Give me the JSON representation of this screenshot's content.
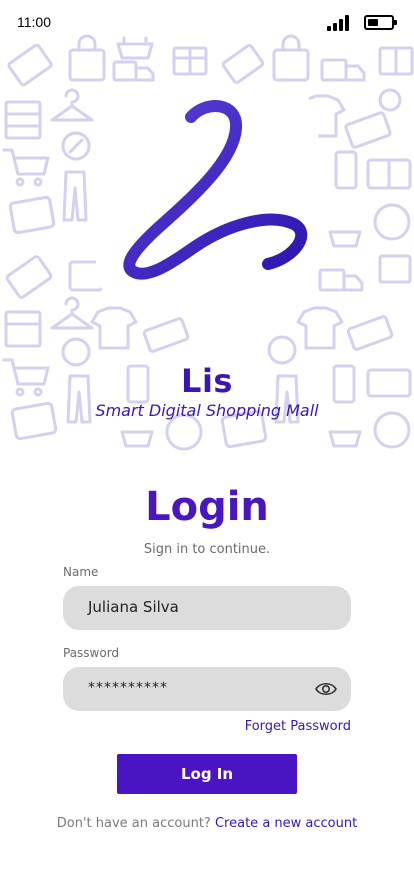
{
  "status_bar": {
    "time": "11:00",
    "signal_icon": "cellular-signal-icon",
    "battery_icon": "battery-icon",
    "battery_level": 0.45
  },
  "hero": {
    "logo_icon": "lis-script-logo",
    "brand_name": "Lis",
    "tagline": "Smart Digital Shopping Mall",
    "pattern_icons": [
      "new-tag-icon",
      "shopping-bag-icon",
      "basket-icon",
      "gift-icon",
      "truck-icon",
      "shirt-icon",
      "percent-icon",
      "cart-icon",
      "wallet-icon",
      "sale-tag-icon",
      "hanger-icon",
      "store-icon",
      "pants-icon",
      "card-icon"
    ],
    "colors": {
      "brand": "#3a16b5",
      "pattern": "#d4d0ef"
    }
  },
  "login": {
    "title": "Login",
    "subtitle": "Sign in to continue.",
    "name_label": "Name",
    "name_value": "Juliana Silva",
    "password_label": "Password",
    "password_value": "**********",
    "show_password_icon": "eye-icon",
    "forgot_label": "Forget Password",
    "login_button": "Log In",
    "no_account_text": "Don't have an account?",
    "create_account_link": "Create a new account",
    "colors": {
      "primary": "#4a14c4",
      "field_bg": "#dcdcdc"
    }
  }
}
